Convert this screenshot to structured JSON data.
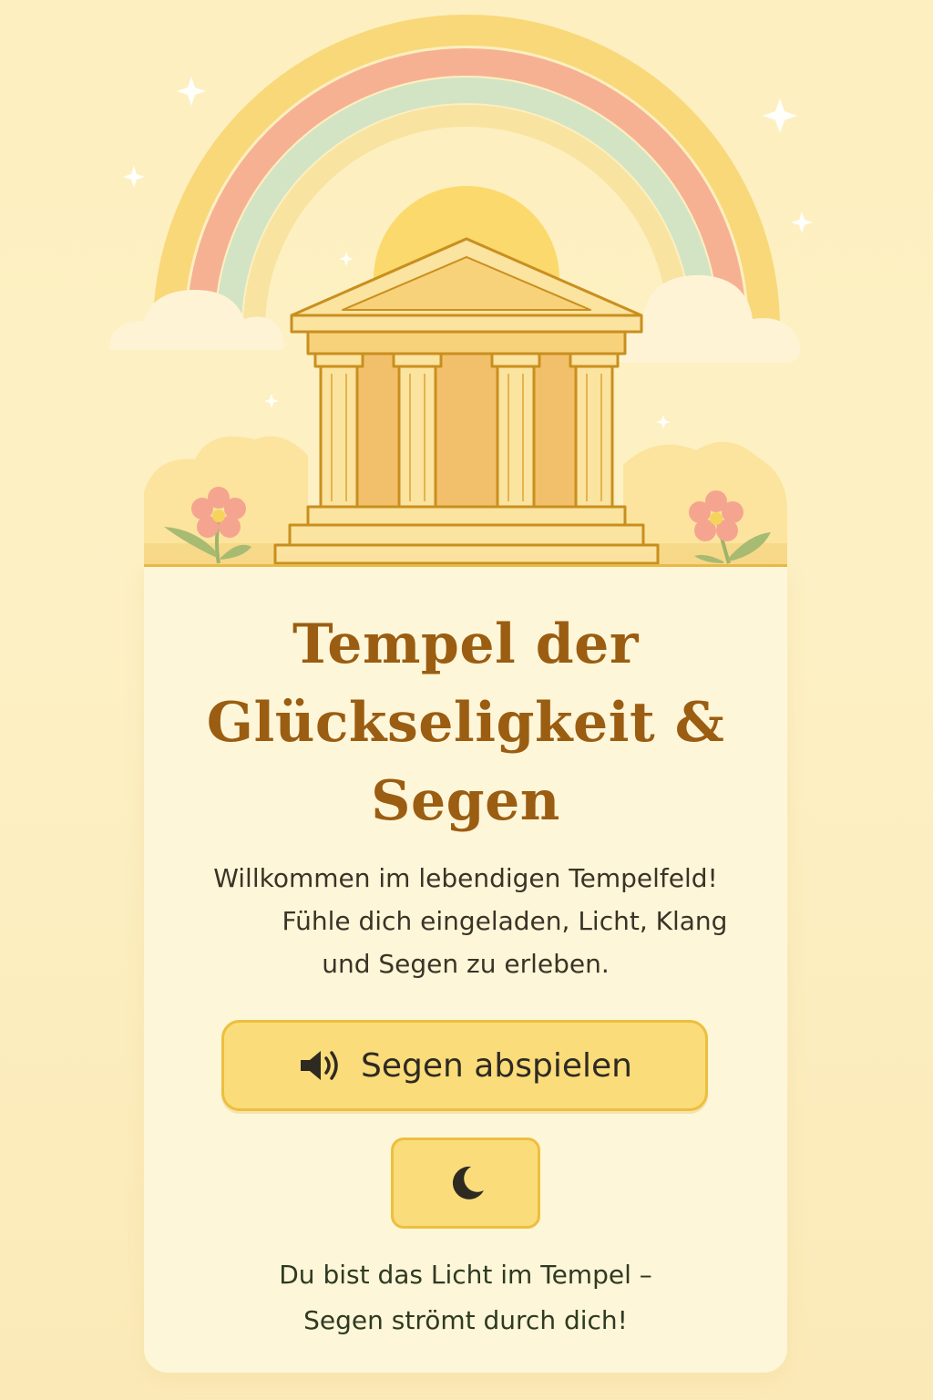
{
  "colors": {
    "background": "#fdf0c4",
    "card": "#fef6d8",
    "title": "#9a5d12",
    "button_fill": "#fbdc7a",
    "button_border": "#ecbf3e",
    "temple": "#f5c96b",
    "rainbow": [
      "#f8d879",
      "#f6b193",
      "#cfe3c4",
      "#f7df8f"
    ]
  },
  "hero": {
    "icons": [
      "rainbow-icon",
      "temple-icon",
      "cloud-icon",
      "flower-icon",
      "sparkle-icon",
      "sun-icon"
    ]
  },
  "title": {
    "line1": "Tempel der",
    "line2": "Glückseligkeit &",
    "line3": "Segen"
  },
  "welcome": {
    "line1": "Willkommen im lebendigen Tempelfeld!",
    "line2": "Fühle dich eingeladen, Licht, Klang",
    "line3": "und Segen zu erleben."
  },
  "play_button": {
    "icon": "speaker-icon",
    "label": "Segen abspielen"
  },
  "theme_button": {
    "icon": "moon-icon"
  },
  "closing": {
    "line1": "Du bist das Licht im Tempel –",
    "line2": "Segen strömt durch dich!"
  }
}
